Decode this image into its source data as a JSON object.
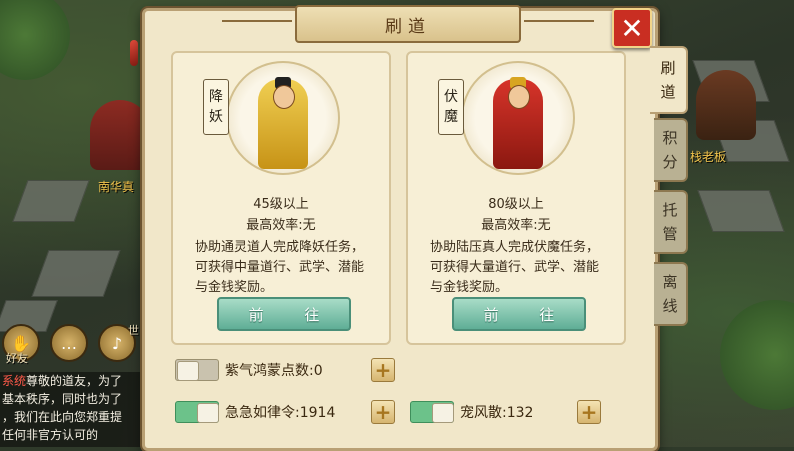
{
  "dialog": {
    "title": "刷道",
    "close_icon": "close-icon"
  },
  "tabs": [
    {
      "label": "刷道",
      "active": true
    },
    {
      "label": "积分",
      "active": false
    },
    {
      "label": "托管",
      "active": false
    },
    {
      "label": "离线",
      "active": false
    }
  ],
  "cards": [
    {
      "badge": "降妖",
      "level": "45级以上",
      "efficiency": "最高效率:无",
      "desc": "协助通灵道人完成降妖任务，可获得中量道行、武学、潜能与金钱奖励。",
      "button": "前 往",
      "figure_color": "#e2b32f"
    },
    {
      "badge": "伏魔",
      "level": "80级以上",
      "efficiency": "最高效率:无",
      "desc": "协助陆压真人完成伏魔任务，可获得大量道行、武学、潜能与金钱奖励。",
      "button": "前 往",
      "figure_color": "#b8231a"
    }
  ],
  "items": {
    "ziqi": {
      "label": "紫气鸿蒙点数:0",
      "enabled": false
    },
    "jiji": {
      "label": "急急如律令:1914",
      "enabled": true
    },
    "chongfeng": {
      "label": "宠风散:132",
      "enabled": true
    }
  },
  "scene": {
    "npc_left": "南华真",
    "npc_right": "栈老板"
  },
  "chat": {
    "friends_label": "好友",
    "voice_label": "世",
    "lines": [
      {
        "tag": "系统",
        "text": "尊敬的道友，为了"
      },
      {
        "tag": "",
        "text": "基本秩序，同时也为了"
      },
      {
        "tag": "",
        "text": "，我们在此向您郑重提"
      },
      {
        "tag": "",
        "text": "任何非官方认可的"
      }
    ]
  }
}
